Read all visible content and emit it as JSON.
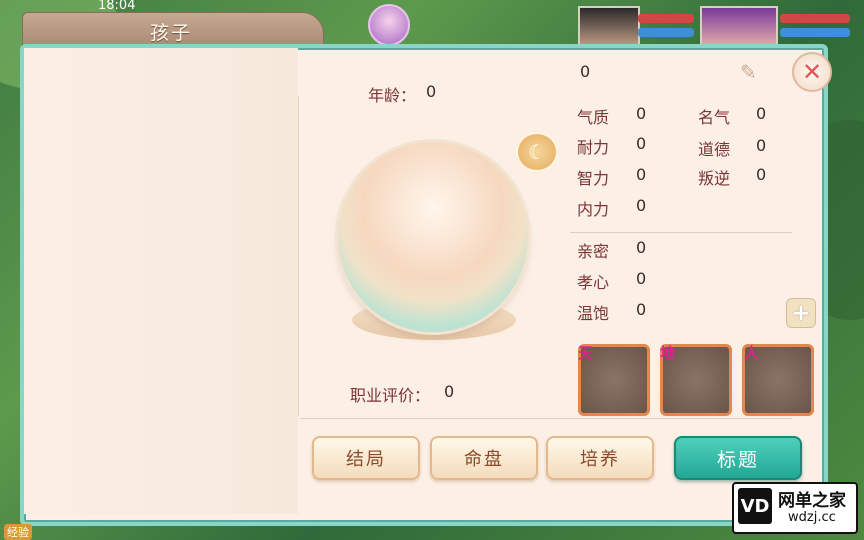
{
  "statusbar": {
    "time": "18:04"
  },
  "window": {
    "title": "孩子"
  },
  "child": {
    "age_label": "年龄：",
    "age_value": "0",
    "name_value": "0",
    "career_label": "职业评价：",
    "career_value": "0"
  },
  "stats_left": [
    {
      "label": "气质",
      "value": "0"
    },
    {
      "label": "耐力",
      "value": "0"
    },
    {
      "label": "智力",
      "value": "0"
    },
    {
      "label": "内力",
      "value": "0"
    }
  ],
  "stats_right": [
    {
      "label": "名气",
      "value": "0"
    },
    {
      "label": "道德",
      "value": "0"
    },
    {
      "label": "叛逆",
      "value": "0"
    }
  ],
  "stats_bottom": [
    {
      "label": "亲密",
      "value": "0"
    },
    {
      "label": "孝心",
      "value": "0"
    },
    {
      "label": "温饱",
      "value": "0"
    }
  ],
  "slots": [
    {
      "tag": "天"
    },
    {
      "tag": "地"
    },
    {
      "tag": "人"
    }
  ],
  "buttons": {
    "ending": "结局",
    "fate": "命盘",
    "train": "培养",
    "titles": "标题"
  },
  "watermark": {
    "logo": "VD",
    "line1": "网单之家",
    "line2": "wdzj.cc"
  },
  "bottom_tag": "经验",
  "icons": {
    "close": "close-icon",
    "edit": "pen-icon",
    "moon": "moon-icon",
    "add": "plus-icon"
  },
  "colors": {
    "accent": "#22a894",
    "label": "#7a3535",
    "slot_border": "#e3874f"
  }
}
